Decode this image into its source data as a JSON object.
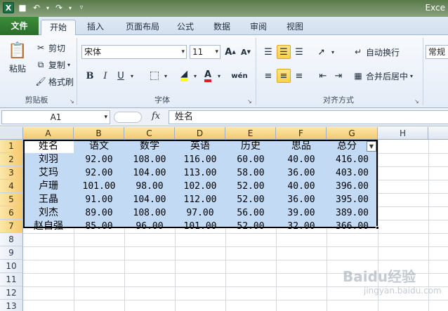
{
  "window": {
    "title": "Exce"
  },
  "tabs": [
    "文件",
    "开始",
    "插入",
    "页面布局",
    "公式",
    "数据",
    "审阅",
    "视图"
  ],
  "ribbon": {
    "clipboard": {
      "paste": "粘贴",
      "cut": "剪切",
      "copy": "复制",
      "format_painter": "格式刷",
      "label": "剪贴板"
    },
    "font": {
      "name": "宋体",
      "size": "11",
      "label": "字体",
      "bold": "B",
      "italic": "I",
      "underline": "U",
      "grow": "A",
      "shrink": "A",
      "phonetic": "wén"
    },
    "alignment": {
      "wrap": "自动换行",
      "merge": "合并后居中",
      "label": "对齐方式"
    },
    "number": {
      "format": "常规"
    }
  },
  "formula_bar": {
    "name_box": "A1",
    "fx": "fx",
    "content": "姓名"
  },
  "columns": [
    "A",
    "B",
    "C",
    "D",
    "E",
    "F",
    "G",
    "H"
  ],
  "rows": [
    "1",
    "2",
    "3",
    "4",
    "5",
    "6",
    "7",
    "8",
    "9",
    "10",
    "11",
    "12",
    "13"
  ],
  "table": [
    [
      "姓名",
      "语文",
      "数学",
      "英语",
      "历史",
      "思品",
      "总分"
    ],
    [
      "刘羽",
      "92.00",
      "108.00",
      "116.00",
      "60.00",
      "40.00",
      "416.00"
    ],
    [
      "艾玛",
      "92.00",
      "104.00",
      "113.00",
      "58.00",
      "36.00",
      "403.00"
    ],
    [
      "卢珊",
      "101.00",
      "98.00",
      "102.00",
      "52.00",
      "40.00",
      "396.00"
    ],
    [
      "王晶",
      "91.00",
      "104.00",
      "112.00",
      "52.00",
      "36.00",
      "395.00"
    ],
    [
      "刘杰",
      "89.00",
      "108.00",
      "97.00",
      "56.00",
      "39.00",
      "389.00"
    ],
    [
      "赵自强",
      "85.00",
      "96.00",
      "101.00",
      "52.00",
      "32.00",
      "366.00"
    ]
  ],
  "watermark": {
    "brand": "Baidu经验",
    "url": "jingyan.baidu.com"
  }
}
